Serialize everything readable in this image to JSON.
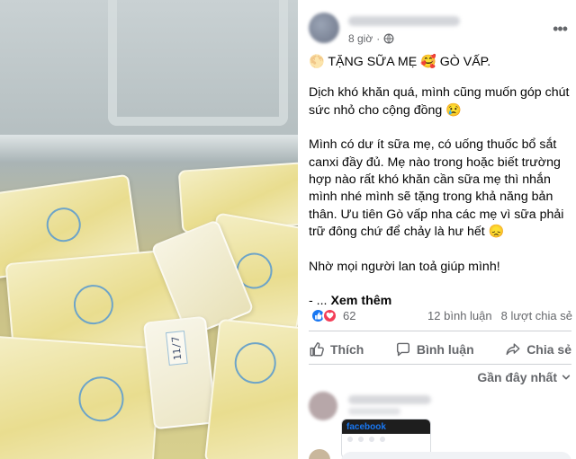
{
  "post": {
    "time": "8 giờ",
    "separator": "·",
    "headline": "🌕 TẶNG SỮA MẸ 🥰 GÒ VẤP.",
    "paragraphs": [
      "Dịch khó khăn quá, mình cũng muốn góp chút sức nhỏ cho cộng đồng 😢",
      "Mình có dư ít sữa mẹ, có uống thuốc bổ sắt canxi đầy đủ. Mẹ nào trong hoặc biết trường hợp nào rất khó khăn cần sữa mẹ thì nhắn mình nhé mình sẽ tặng trong khả năng bản thân. Ưu tiên Gò vấp nha các mẹ vì sữa phải trữ đông chứ để chảy là hư hết 😞",
      "Nhờ mọi người lan toả giúp mình!"
    ],
    "see_more_prefix": "- ...",
    "see_more": "Xem thêm"
  },
  "stats": {
    "reaction_count": "62",
    "comments": "12 bình luận",
    "shares": "8 lượt chia sẻ"
  },
  "actions": {
    "like": "Thích",
    "comment": "Bình luận",
    "share": "Chia sẻ"
  },
  "comments": {
    "sort_label": "Gần đây nhất"
  },
  "photo": {
    "label_date": "11/7"
  },
  "thumb": {
    "logo": "facebook"
  },
  "colors": {
    "like_blue": "#1877f2",
    "love_red": "#f33e58",
    "muted_text": "#65676b",
    "divider": "#ced0d4"
  },
  "icons": [
    "globe-icon",
    "more-icon",
    "like-reaction-icon",
    "love-reaction-icon",
    "thumbs-up-icon",
    "comment-icon",
    "share-icon",
    "chevron-down-icon"
  ]
}
